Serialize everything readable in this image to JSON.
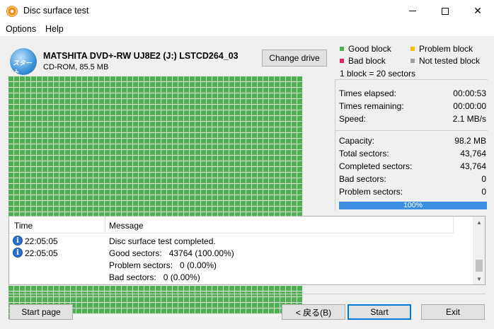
{
  "window": {
    "title": "Disc surface test",
    "min_icon": "minimize-icon",
    "max_icon": "maximize-icon",
    "close_glyph": "✕"
  },
  "menu": {
    "options": "Options",
    "help": "Help"
  },
  "drive": {
    "icon_label": "スタート",
    "name": "MATSHITA DVD+-RW UJ8E2 (J:) LSTCD264_03",
    "info": "CD-ROM, 85.5 MB",
    "change_button": "Change drive"
  },
  "legend": {
    "good": {
      "label": "Good block",
      "color": "#4caf50"
    },
    "problem": {
      "label": "Problem block",
      "color": "#f0c400"
    },
    "bad": {
      "label": "Bad block",
      "color": "#e0245e"
    },
    "not_tested": {
      "label": "Not tested block",
      "color": "#9e9e9e"
    },
    "block_note": "1 block = 20 sectors"
  },
  "blocks": {
    "good_count": 2188
  },
  "stats": {
    "times_elapsed": {
      "label": "Times elapsed:",
      "value": "00:00:53"
    },
    "times_remaining": {
      "label": "Times remaining:",
      "value": "00:00:00"
    },
    "speed": {
      "label": "Speed:",
      "value": "2.1 MB/s"
    },
    "capacity": {
      "label": "Capacity:",
      "value": "98.2 MB"
    },
    "total_sectors": {
      "label": "Total sectors:",
      "value": "43,764"
    },
    "completed_sectors": {
      "label": "Completed sectors:",
      "value": "43,764"
    },
    "bad_sectors": {
      "label": "Bad sectors:",
      "value": "0"
    },
    "problem_sectors": {
      "label": "Problem sectors:",
      "value": "0"
    }
  },
  "progress": {
    "text": "100%",
    "fraction": 1.0
  },
  "log": {
    "columns": {
      "time": "Time",
      "message": "Message"
    },
    "rows": [
      {
        "time": "22:05:05",
        "message": "Disc surface test completed.",
        "icon": "info-icon"
      },
      {
        "time": "22:05:05",
        "message": "Good sectors:   43764 (100.00%)",
        "icon": "info-icon"
      },
      {
        "time": "",
        "message": "Problem sectors:   0 (0.00%)",
        "icon": ""
      },
      {
        "time": "",
        "message": "Bad sectors:   0 (0.00%)",
        "icon": ""
      }
    ]
  },
  "buttons": {
    "start_page": "Start page",
    "back": "< 戻る(B)",
    "start": "Start",
    "exit": "Exit"
  }
}
